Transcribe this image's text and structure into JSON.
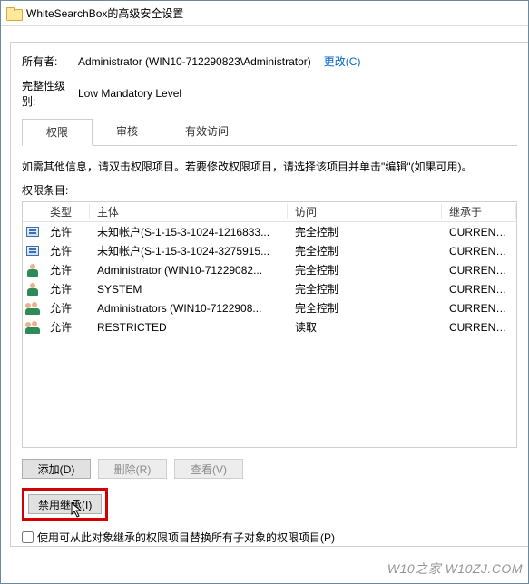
{
  "window": {
    "title": "WhiteSearchBox的高级安全设置"
  },
  "owner": {
    "label": "所有者:",
    "value": "Administrator (WIN10-712290823\\Administrator)",
    "change_link": "更改(C)"
  },
  "integrity": {
    "label": "完整性级别:",
    "value": "Low Mandatory Level"
  },
  "tabs": {
    "items": [
      {
        "label": "权限",
        "active": true
      },
      {
        "label": "审核",
        "active": false
      },
      {
        "label": "有效访问",
        "active": false
      }
    ]
  },
  "hint": "如需其他信息，请双击权限项目。若要修改权限项目，请选择该项目并单击\"编辑\"(如果可用)。",
  "entries_label": "权限条目:",
  "table": {
    "headers": {
      "type": "类型",
      "principal": "主体",
      "access": "访问",
      "inherited": "继承于"
    },
    "rows": [
      {
        "icon": "account",
        "type": "允许",
        "principal": "未知帐户(S-1-15-3-1024-1216833...",
        "access": "完全控制",
        "inherited": "CURRENT_USER"
      },
      {
        "icon": "account",
        "type": "允许",
        "principal": "未知帐户(S-1-15-3-1024-3275915...",
        "access": "完全控制",
        "inherited": "CURRENT_USER"
      },
      {
        "icon": "user",
        "type": "允许",
        "principal": "Administrator (WIN10-71229082...",
        "access": "完全控制",
        "inherited": "CURRENT_USER"
      },
      {
        "icon": "user",
        "type": "允许",
        "principal": "SYSTEM",
        "access": "完全控制",
        "inherited": "CURRENT_USER"
      },
      {
        "icon": "group",
        "type": "允许",
        "principal": "Administrators (WIN10-7122908...",
        "access": "完全控制",
        "inherited": "CURRENT_USER"
      },
      {
        "icon": "group",
        "type": "允许",
        "principal": "RESTRICTED",
        "access": "读取",
        "inherited": "CURRENT_USER"
      }
    ]
  },
  "buttons": {
    "add": "添加(D)",
    "remove": "删除(R)",
    "view": "查看(V)",
    "disable_inherit": "禁用继承(I)"
  },
  "replace_checkbox": {
    "label": "使用可从此对象继承的权限项目替换所有子对象的权限项目(P)",
    "checked": false
  },
  "watermark": "W10之家 W10ZJ.COM"
}
